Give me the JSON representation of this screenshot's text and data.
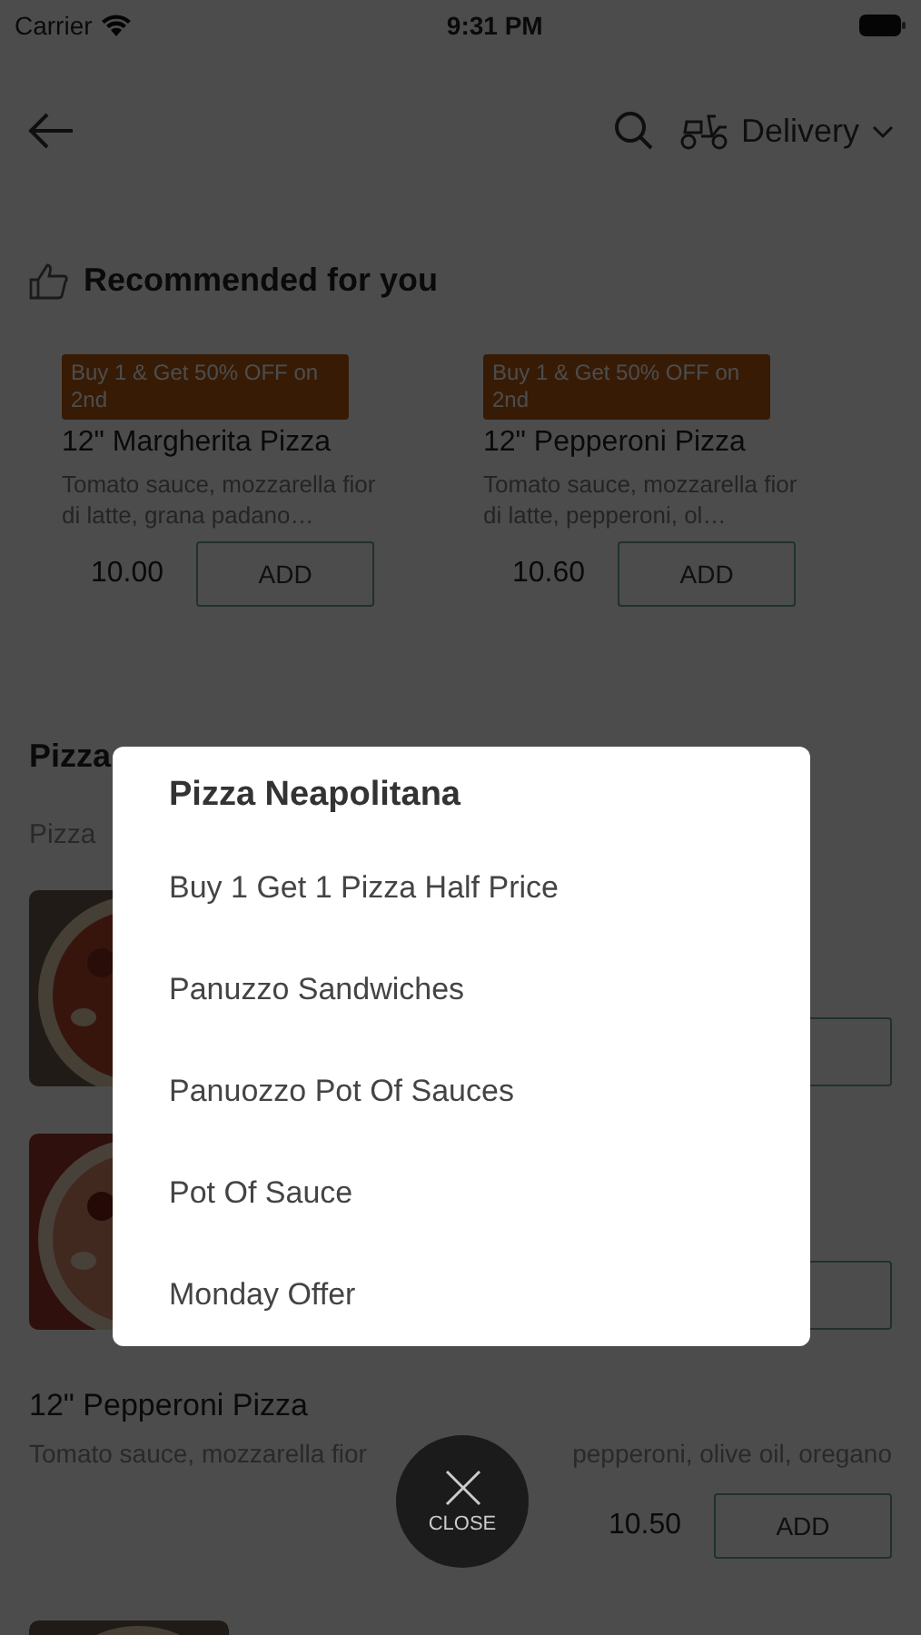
{
  "status_bar": {
    "carrier": "Carrier",
    "time": "9:31 PM"
  },
  "header": {
    "delivery_mode": "Delivery"
  },
  "recommended": {
    "title": "Recommended for you",
    "items": [
      {
        "badge": "Buy 1 & Get 50% OFF on 2nd",
        "name": "12\" Margherita Pizza",
        "description": "Tomato sauce, mozzarella fior di latte, grana padano…",
        "price": "10.00",
        "button": "ADD"
      },
      {
        "badge": "Buy 1 & Get 50% OFF on 2nd",
        "name": "12\" Pepperoni Pizza",
        "description": "Tomato sauce, mozzarella fior di latte, pepperoni, ol…",
        "price": "10.60",
        "button": "ADD"
      }
    ]
  },
  "menu": {
    "section_title": "Pizza",
    "subtitle": "Pizza",
    "items": [
      {
        "kind": "picture_row"
      },
      {
        "kind": "picture_row"
      },
      {
        "kind": "text_row",
        "name": "12\" Pepperoni Pizza",
        "description_parts": [
          "Tomato sauce, mozzarella fior",
          "pepperoni, olive oil, oregano"
        ],
        "price": "10.50",
        "button": "ADD"
      },
      {
        "kind": "picture_stub"
      }
    ]
  },
  "category_menu": {
    "title": "Pizza Neapolitana",
    "items": [
      "Buy 1 Get 1 Pizza Half Price",
      "Panuzzo Sandwiches",
      "Panuozzo Pot Of Sauces",
      "Pot Of Sauce",
      "Monday Offer"
    ]
  },
  "close_button": {
    "label": "CLOSE"
  }
}
